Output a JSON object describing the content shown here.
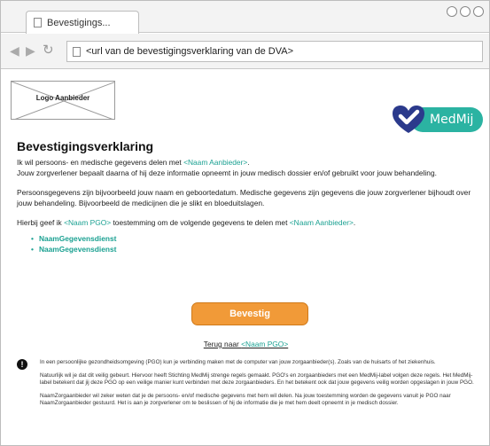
{
  "browser": {
    "tab_title": "Bevestigings...",
    "url": "<url van de bevestigingsverklaring van de DVA>"
  },
  "header": {
    "logo_placeholder": "Logo Aanbieder",
    "medmij_logo_text": "MedMij",
    "brand_color": "#2bb3a2"
  },
  "main": {
    "title": "Bevestigingsverklaring",
    "intro_part1": "Ik wil persoons- en medische gegevens delen met ",
    "intro_provider": "<Naam Aanbieder>",
    "intro_part2": ".",
    "intro_line2": "Jouw zorgverlener bepaalt daarna of hij deze informatie opneemt in jouw medisch dossier en/of gebruikt voor jouw behandeling.",
    "para2": "Persoonsgegevens zijn bijvoorbeeld jouw naam en geboortedatum. Medische gegevens zijn gegevens die jouw zorgverlener bijhoudt over jouw behandeling. Bijvoorbeeld de medicijnen die je slikt en bloeduitslagen.",
    "consent_part1": "Hierbij geef ik ",
    "consent_pgo": "<Naam PGO>",
    "consent_part2": " toestemming om de volgende gegevens te delen met ",
    "consent_provider": "<Naam Aanbieder>",
    "consent_part3": ".",
    "services": [
      "NaamGegevensdienst",
      "NaamGegevensdienst"
    ]
  },
  "actions": {
    "confirm_label": "Bevestig",
    "confirm_color": "#f19a38",
    "back_prefix": "Terug naar ",
    "back_target": "<Naam PGO>"
  },
  "info": {
    "p1": "In een persoonlijke gezondheidsomgeving (PGO) kun je verbinding maken met de computer van jouw zorgaanbieder(s). Zoals van de huisarts of het ziekenhuis.",
    "p2": "Natuurlijk wil je dat dit veilig gebeurt. Hiervoor heeft Stichting MedMij strenge regels gemaakt. PGO's en zorgaanbieders met een MedMij-label volgen deze regels. Het MedMij-label betekent dat jij deze PGO op een veilige manier kunt verbinden met deze zorgaanbieders. En het betekent ook dat jouw gegevens veilig worden opgeslagen in jouw PGO.",
    "p3": "NaamZorgaanbieder wil zeker weten dat je de persoons- en/of medische gegevens met hem wil delen. Na jouw toestemming worden de gegevens vanuit je PGO naar NaamZorgaanbieder gestuurd. Het is aan je zorgverlener om te beslissen of hij de informatie die je met hem deelt opneemt in je medisch dossier."
  }
}
